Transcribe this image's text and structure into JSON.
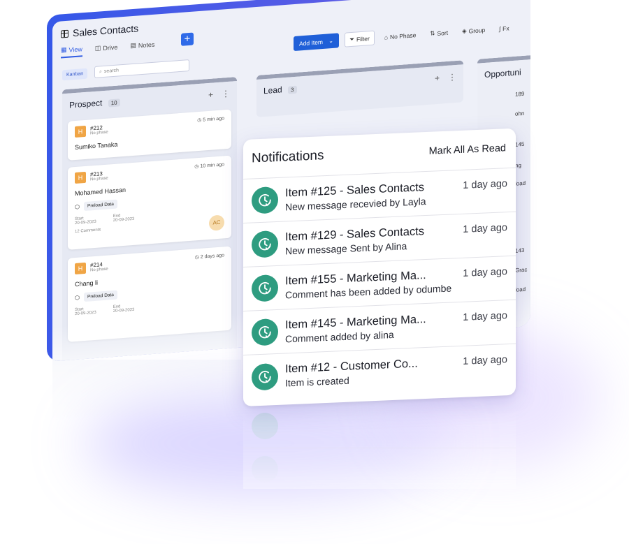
{
  "app": {
    "title": "Sales Contacts",
    "tabs": [
      {
        "label": "View",
        "icon": "view-icon"
      },
      {
        "label": "Drive",
        "icon": "drive-icon"
      },
      {
        "label": "Notes",
        "icon": "notes-icon"
      }
    ],
    "add_tab_label": "+",
    "toolbar": {
      "add_item": "Add Item",
      "filter": "Filter",
      "no_phase": "No Phase",
      "sort": "Sort",
      "group": "Group",
      "fx": "Fx"
    },
    "view_chip": "Kanban",
    "search_placeholder": "search",
    "columns": {
      "prospect": {
        "title": "Prospect",
        "count": "10",
        "cards": [
          {
            "badge": "H",
            "id": "#212",
            "phase": "No phase",
            "time": "5 min ago",
            "name": "Sumiko Tanaka"
          },
          {
            "badge": "H",
            "id": "#213",
            "phase": "No phase",
            "time": "10 min ago",
            "name": "Mohamed Hassan",
            "tag": "Preload Data",
            "start_label": "Start",
            "start": "20-09-2023",
            "end_label": "End",
            "end": "20-09-2023",
            "comments": "12 Comments",
            "avatar": "AC"
          },
          {
            "badge": "H",
            "id": "#214",
            "phase": "No phase",
            "time": "2 days ago",
            "name": "Chang li",
            "tag": "Preload Data",
            "start_label": "Start",
            "start": "20-09-2023",
            "end_label": "End",
            "end": "20-09-2023"
          }
        ]
      },
      "lead": {
        "title": "Lead",
        "count": "3"
      },
      "opportunity": {
        "title": "Opportuni",
        "snippets": [
          "189",
          "ohn",
          "145",
          "ng",
          "load",
          "143",
          "Grac",
          "load"
        ]
      }
    }
  },
  "notifications": {
    "title": "Notifications",
    "mark_all": "Mark All As Read",
    "items": [
      {
        "title": "Item #125 - Sales Contacts",
        "subtitle": "New message recevied by Layla",
        "time": "1 day ago"
      },
      {
        "title": "Item #129 - Sales Contacts",
        "subtitle": "New message Sent by Alina",
        "time": "1 day ago"
      },
      {
        "title": "Item #155 - Marketing Ma...",
        "subtitle": "Comment has been added by odumbe",
        "time": "1 day ago"
      },
      {
        "title": "Item #145 - Marketing Ma...",
        "subtitle": "Comment added by alina",
        "time": "1 day ago"
      },
      {
        "title": "Item #12 - Customer Co...",
        "subtitle": "Item is created",
        "time": "1 day ago"
      }
    ],
    "icon": "clock-check-icon",
    "accent": "#2e9c80"
  },
  "colors": {
    "brand": "#2f5be3",
    "badge": "#f0a545"
  }
}
